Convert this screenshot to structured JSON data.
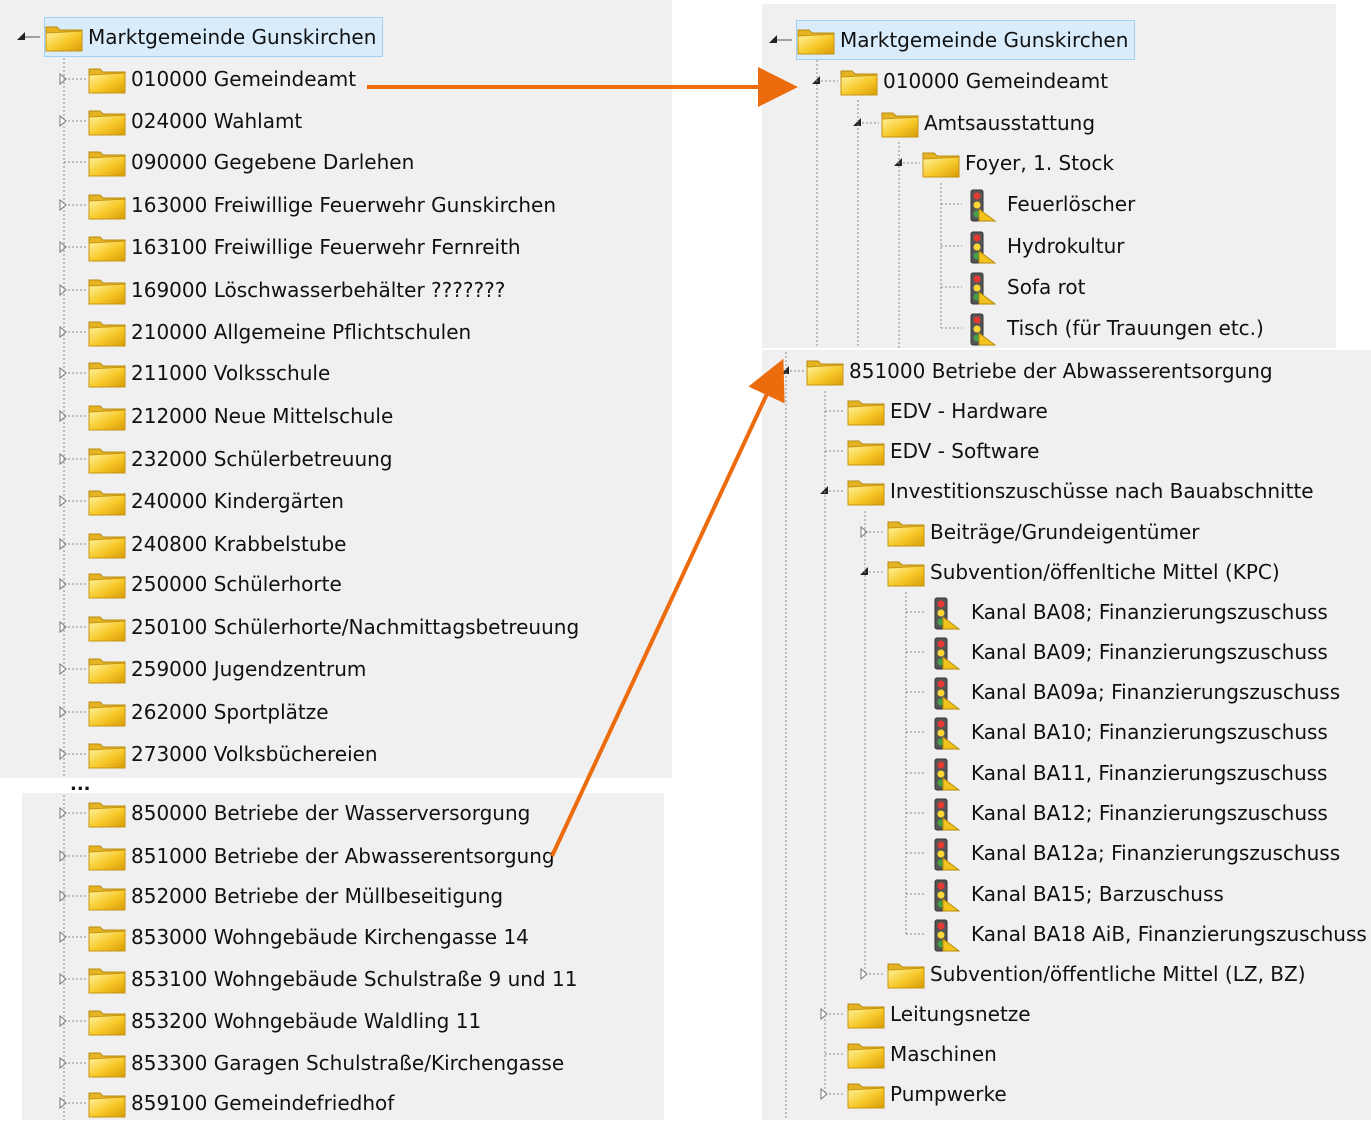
{
  "left_tree": {
    "root_label": "Marktgemeinde Gunskirchen",
    "items": [
      {
        "label": "010000 Gemeindeamt",
        "icon": "folder-icon"
      },
      {
        "label": "024000 Wahlamt",
        "icon": "folder-icon"
      },
      {
        "label": "090000 Gegebene Darlehen",
        "icon": "folder-icon"
      },
      {
        "label": "163000 Freiwillige Feuerwehr Gunskirchen",
        "icon": "folder-icon"
      },
      {
        "label": "163100 Freiwillige Feuerwehr Fernreith",
        "icon": "folder-icon"
      },
      {
        "label": "169000 Löschwasserbehälter ???????",
        "icon": "folder-icon"
      },
      {
        "label": "210000 Allgemeine Pflichtschulen",
        "icon": "folder-icon"
      },
      {
        "label": "211000 Volksschule",
        "icon": "folder-icon"
      },
      {
        "label": "212000 Neue Mittelschule",
        "icon": "folder-icon"
      },
      {
        "label": "232000 Schülerbetreuung",
        "icon": "folder-icon"
      },
      {
        "label": "240000 Kindergärten",
        "icon": "folder-icon"
      },
      {
        "label": "240800 Krabbelstube",
        "icon": "folder-icon"
      },
      {
        "label": "250000 Schülerhorte",
        "icon": "folder-icon"
      },
      {
        "label": "250100 Schülerhorte/Nachmittagsbetreuung",
        "icon": "folder-icon"
      },
      {
        "label": "259000 Jugendzentrum",
        "icon": "folder-icon"
      },
      {
        "label": "262000 Sportplätze",
        "icon": "folder-icon"
      },
      {
        "label": "273000 Volksbüchereien",
        "icon": "folder-icon"
      }
    ],
    "ellipsis": "...",
    "items_after": [
      {
        "label": "850000 Betriebe der Wasserversorgung",
        "icon": "folder-icon"
      },
      {
        "label": "851000 Betriebe der Abwasserentsorgung",
        "icon": "folder-icon"
      },
      {
        "label": "852000 Betriebe der Müllbeseitigung",
        "icon": "folder-icon"
      },
      {
        "label": "853000 Wohngebäude Kirchengasse 14",
        "icon": "folder-icon"
      },
      {
        "label": "853100 Wohngebäude Schulstraße 9 und 11",
        "icon": "folder-icon"
      },
      {
        "label": "853200 Wohngebäude Waldling 11",
        "icon": "folder-icon"
      },
      {
        "label": "853300 Garagen Schulstraße/Kirchengasse",
        "icon": "folder-icon"
      },
      {
        "label": "859100 Gemeindefriedhof",
        "icon": "folder-icon"
      }
    ]
  },
  "right_tree_top": {
    "root_label": "Marktgemeinde Gunskirchen",
    "items": [
      {
        "label": "010000 Gemeindeamt",
        "icon": "folder-icon",
        "level": 1
      },
      {
        "label": "Amtsausstattung",
        "icon": "folder-icon",
        "level": 2
      },
      {
        "label": "Foyer, 1. Stock",
        "icon": "folder-icon",
        "level": 3
      },
      {
        "label": "Feuerlöscher",
        "icon": "traffic-light-icon",
        "level": 4
      },
      {
        "label": "Hydrokultur",
        "icon": "traffic-light-icon",
        "level": 4
      },
      {
        "label": "Sofa rot",
        "icon": "traffic-light-icon",
        "level": 4
      },
      {
        "label": "Tisch (für Trauungen etc.)",
        "icon": "traffic-light-icon",
        "level": 4
      }
    ]
  },
  "right_tree_bottom": {
    "items": [
      {
        "label": "851000 Betriebe der Abwasserentsorgung",
        "icon": "folder-icon",
        "level": 0
      },
      {
        "label": "EDV - Hardware",
        "icon": "folder-icon",
        "level": 1
      },
      {
        "label": "EDV - Software",
        "icon": "folder-icon",
        "level": 1
      },
      {
        "label": "Investitionszuschüsse nach Bauabschnitte",
        "icon": "folder-icon",
        "level": 1
      },
      {
        "label": "Beiträge/Grundeigentümer",
        "icon": "folder-icon",
        "level": 2
      },
      {
        "label": "Subvention/öffenltiche Mittel (KPC)",
        "icon": "folder-icon",
        "level": 2
      },
      {
        "label": "Kanal BA08; Finanzierungszuschuss",
        "icon": "traffic-light-icon",
        "level": 3
      },
      {
        "label": "Kanal BA09; Finanzierungszuschuss",
        "icon": "traffic-light-icon",
        "level": 3
      },
      {
        "label": "Kanal BA09a; Finanzierungszuschuss",
        "icon": "traffic-light-icon",
        "level": 3
      },
      {
        "label": "Kanal BA10; Finanzierungszuschuss",
        "icon": "traffic-light-icon",
        "level": 3
      },
      {
        "label": "Kanal BA11, Finanzierungszuschuss",
        "icon": "traffic-light-icon",
        "level": 3
      },
      {
        "label": "Kanal BA12; Finanzierungszuschuss",
        "icon": "traffic-light-icon",
        "level": 3
      },
      {
        "label": "Kanal BA12a; Finanzierungszuschuss",
        "icon": "traffic-light-icon",
        "level": 3
      },
      {
        "label": "Kanal BA15; Barzuschuss",
        "icon": "traffic-light-icon",
        "level": 3
      },
      {
        "label": "Kanal BA18 AiB, Finanzierungszuschuss",
        "icon": "traffic-light-icon",
        "level": 3
      },
      {
        "label": "Subvention/öffentliche Mittel (LZ, BZ)",
        "icon": "folder-icon",
        "level": 2
      },
      {
        "label": "Leitungsnetze",
        "icon": "folder-icon",
        "level": 1
      },
      {
        "label": "Maschinen",
        "icon": "folder-icon",
        "level": 1
      },
      {
        "label": "Pumpwerke",
        "icon": "folder-icon",
        "level": 1
      }
    ]
  },
  "colors": {
    "panel_bg": "#f0f0f0",
    "selection_bg": "#d8ecfb",
    "selection_border": "#9fd1f6",
    "arrow": "#ec6b0c",
    "tree_line": "#8a8a8a"
  }
}
